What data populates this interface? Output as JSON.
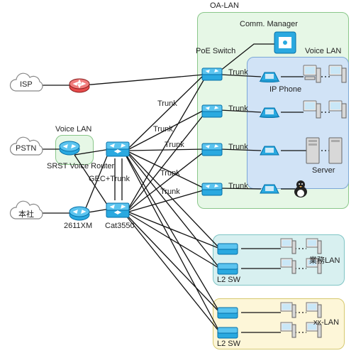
{
  "zones": {
    "oa_lan": "OA-LAN",
    "voice_lan_right": "Voice LAN",
    "voice_lan_left": "Voice LAN",
    "biz_lan": "業務LAN",
    "xx_lan": "xx-LAN"
  },
  "clouds": {
    "isp": "ISP",
    "pstn": "PSTN",
    "hq": "本社"
  },
  "devices": {
    "isp_router": "",
    "srst": "SRST Voice\nRouter",
    "r2611xm": "2611XM",
    "cat3550_top": "GEC+Trunk",
    "cat3550_bottom": "Cat3550",
    "comm_manager": "Comm. Manager",
    "poe_switch": "PoE\nSwitch",
    "ip_phone": "IP Phone",
    "server": "Server",
    "l2sw_biz": "L2 SW",
    "l2sw_xx": "L2 SW"
  },
  "link_labels": {
    "trunk": "Trunk"
  },
  "chart_data": {
    "type": "network-topology",
    "nodes": [
      {
        "id": "isp",
        "kind": "cloud",
        "label": "ISP"
      },
      {
        "id": "pstn",
        "kind": "cloud",
        "label": "PSTN"
      },
      {
        "id": "hq",
        "kind": "cloud",
        "label": "本社"
      },
      {
        "id": "isp_rtr",
        "kind": "router"
      },
      {
        "id": "srst",
        "kind": "voice-router",
        "label": "SRST Voice Router"
      },
      {
        "id": "r2611",
        "kind": "router",
        "label": "2611XM"
      },
      {
        "id": "cat_a",
        "kind": "l3-switch",
        "label": "Cat3550"
      },
      {
        "id": "cat_b",
        "kind": "l3-switch",
        "label": "Cat3550"
      },
      {
        "id": "poe1",
        "kind": "poe-switch",
        "label": "PoE Switch"
      },
      {
        "id": "poe2",
        "kind": "poe-switch"
      },
      {
        "id": "poe3",
        "kind": "poe-switch"
      },
      {
        "id": "poe4",
        "kind": "poe-switch"
      },
      {
        "id": "cm",
        "kind": "server",
        "label": "Comm. Manager"
      },
      {
        "id": "ipphone1",
        "kind": "ip-phone",
        "label": "IP Phone"
      },
      {
        "id": "ipphone2",
        "kind": "ip-phone"
      },
      {
        "id": "pc1",
        "kind": "pc"
      },
      {
        "id": "pc2",
        "kind": "pc"
      },
      {
        "id": "srv",
        "kind": "server",
        "label": "Server"
      },
      {
        "id": "l2biz1",
        "kind": "l2-switch",
        "label": "L2 SW"
      },
      {
        "id": "l2biz2",
        "kind": "l2-switch"
      },
      {
        "id": "l2xx1",
        "kind": "l2-switch",
        "label": "L2 SW"
      },
      {
        "id": "l2xx2",
        "kind": "l2-switch"
      },
      {
        "id": "biz_pc1",
        "kind": "pc"
      },
      {
        "id": "biz_pc2",
        "kind": "pc"
      },
      {
        "id": "xx_pc1",
        "kind": "pc"
      },
      {
        "id": "xx_pc2",
        "kind": "pc"
      }
    ],
    "zones": [
      {
        "id": "oa",
        "label": "OA-LAN",
        "members": [
          "poe1",
          "poe2",
          "poe3",
          "poe4",
          "cm",
          "ipphone1",
          "ipphone2",
          "pc1",
          "pc2",
          "srv"
        ]
      },
      {
        "id": "voice_r",
        "label": "Voice LAN",
        "members": [
          "ipphone1",
          "ipphone2",
          "pc1",
          "pc2",
          "srv"
        ]
      },
      {
        "id": "voice_l",
        "label": "Voice LAN",
        "members": [
          "srst"
        ]
      },
      {
        "id": "biz",
        "label": "業務LAN",
        "members": [
          "l2biz1",
          "l2biz2",
          "biz_pc1",
          "biz_pc2"
        ]
      },
      {
        "id": "xx",
        "label": "xx-LAN",
        "members": [
          "l2xx1",
          "l2xx2",
          "xx_pc1",
          "xx_pc2"
        ]
      }
    ],
    "links": [
      {
        "a": "isp",
        "b": "isp_rtr"
      },
      {
        "a": "pstn",
        "b": "srst"
      },
      {
        "a": "hq",
        "b": "r2611"
      },
      {
        "a": "isp_rtr",
        "b": "poe1"
      },
      {
        "a": "srst",
        "b": "cat_a"
      },
      {
        "a": "srst",
        "b": "cat_b"
      },
      {
        "a": "r2611",
        "b": "cat_a"
      },
      {
        "a": "r2611",
        "b": "cat_b"
      },
      {
        "a": "cat_a",
        "b": "cat_b",
        "label": "GEC+Trunk",
        "multi": 2
      },
      {
        "a": "cat_a",
        "b": "poe1",
        "label": "Trunk"
      },
      {
        "a": "cat_a",
        "b": "poe2",
        "label": "Trunk"
      },
      {
        "a": "cat_a",
        "b": "poe3",
        "label": "Trunk"
      },
      {
        "a": "cat_a",
        "b": "poe4",
        "label": "Trunk"
      },
      {
        "a": "cat_b",
        "b": "poe1",
        "label": "Trunk"
      },
      {
        "a": "cat_b",
        "b": "poe2",
        "label": "Trunk"
      },
      {
        "a": "cat_b",
        "b": "poe3",
        "label": "Trunk"
      },
      {
        "a": "cat_b",
        "b": "poe4",
        "label": "Trunk"
      },
      {
        "a": "cat_a",
        "b": "l2biz1"
      },
      {
        "a": "cat_a",
        "b": "l2biz2"
      },
      {
        "a": "cat_b",
        "b": "l2biz1"
      },
      {
        "a": "cat_b",
        "b": "l2biz2"
      },
      {
        "a": "cat_a",
        "b": "l2xx1"
      },
      {
        "a": "cat_a",
        "b": "l2xx2"
      },
      {
        "a": "cat_b",
        "b": "l2xx1"
      },
      {
        "a": "cat_b",
        "b": "l2xx2"
      },
      {
        "a": "poe1",
        "b": "cm"
      },
      {
        "a": "poe1",
        "b": "ipphone1",
        "label": "Trunk"
      },
      {
        "a": "ipphone1",
        "b": "pc1"
      },
      {
        "a": "poe2",
        "b": "ipphone2",
        "label": "Trunk"
      },
      {
        "a": "ipphone2",
        "b": "pc2"
      },
      {
        "a": "poe3",
        "b": "srv",
        "label": "Trunk"
      },
      {
        "a": "poe4",
        "b": "penguin",
        "label": "Trunk"
      },
      {
        "a": "l2biz1",
        "b": "biz_pc1"
      },
      {
        "a": "l2biz2",
        "b": "biz_pc2"
      },
      {
        "a": "l2xx1",
        "b": "xx_pc1"
      },
      {
        "a": "l2xx2",
        "b": "xx_pc2"
      }
    ]
  }
}
